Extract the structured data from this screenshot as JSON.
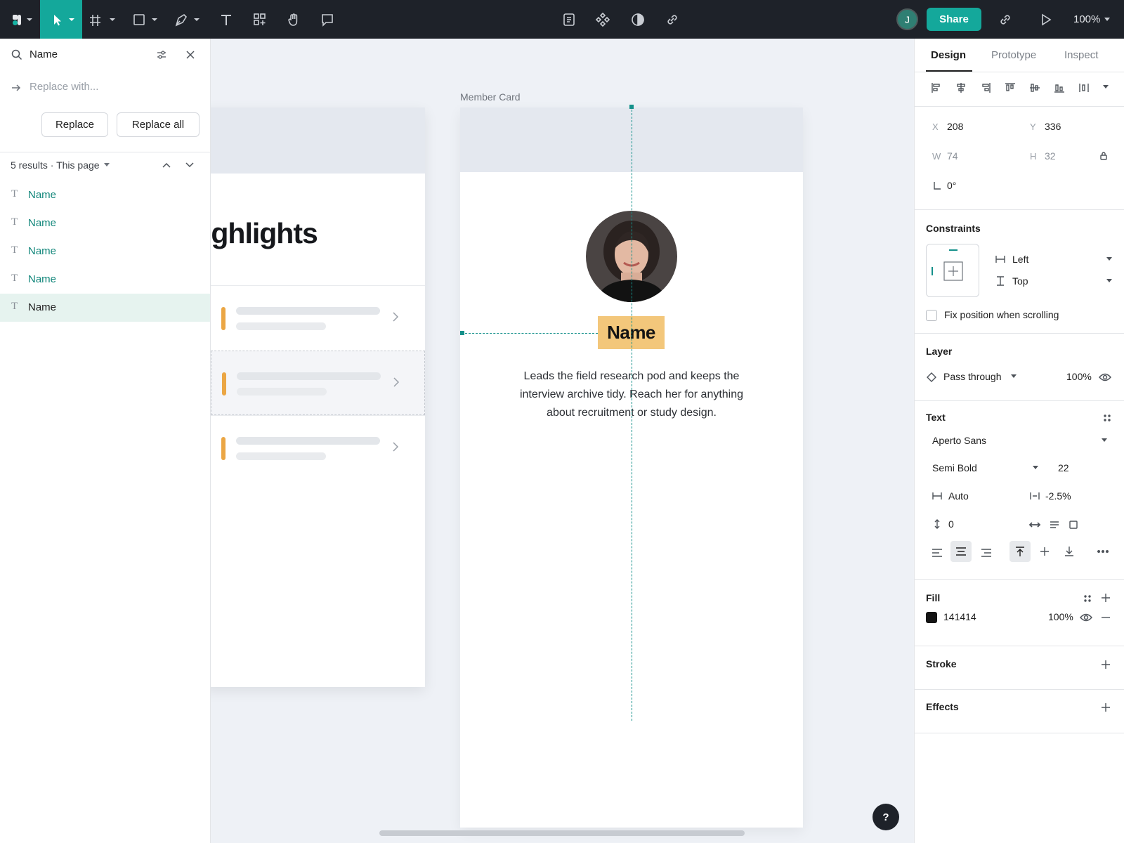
{
  "toolbar": {
    "share_label": "Share",
    "avatar_initial": "J",
    "zoom_label": "100%",
    "accent_color": "#14a89b",
    "icons": [
      "logo-icon",
      "move-tool-icon",
      "frame-tool-icon",
      "shape-tool-icon",
      "pen-tool-icon",
      "text-tool-icon",
      "components-icon",
      "hand-tool-icon",
      "comment-icon",
      "notes-icon",
      "component-diamond-icon",
      "contrast-icon",
      "link-icon",
      "copy-link-icon",
      "play-icon"
    ]
  },
  "find_panel": {
    "search_value": "Name",
    "replace_placeholder": "Replace with...",
    "replace_label": "Replace",
    "replace_all_label": "Replace all",
    "results_summary": "5 results · This page",
    "results": [
      {
        "label": "Name",
        "selected": false
      },
      {
        "label": "Name",
        "selected": false
      },
      {
        "label": "Name",
        "selected": false
      },
      {
        "label": "Name",
        "selected": false
      },
      {
        "label": "Name",
        "selected": true
      }
    ]
  },
  "canvas": {
    "left_frame_heading": "ighlights",
    "frame_label": "Member Card",
    "name_text": "Name",
    "bio_text": "Leads the field research pod and keeps the interview archive tidy. Reach her for anything about recruitment or study design.",
    "help_label": "?"
  },
  "design_panel": {
    "tabs": [
      "Design",
      "Prototype",
      "Inspect"
    ],
    "active_tab": "Design",
    "x_label": "X",
    "x_value": "208",
    "y_label": "Y",
    "y_value": "336",
    "w_label": "W",
    "w_value": "74",
    "h_label": "H",
    "h_value": "32",
    "rotation_value": "0°",
    "constraints_title": "Constraints",
    "constraint_h": "Left",
    "constraint_v": "Top",
    "fix_position_label": "Fix position when scrolling",
    "layer_title": "Layer",
    "blend_mode": "Pass through",
    "layer_opacity": "100%",
    "text_title": "Text",
    "font_family": "Aperto Sans",
    "font_weight": "Semi Bold",
    "font_size": "22",
    "line_height": "Auto",
    "letter_spacing": "-2.5%",
    "paragraph_spacing": "0",
    "fill_title": "Fill",
    "fill_hex": "141414",
    "fill_color": "#141414",
    "fill_opacity": "100%",
    "stroke_title": "Stroke",
    "effects_title": "Effects"
  }
}
